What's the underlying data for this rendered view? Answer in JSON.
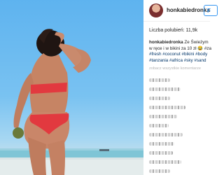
{
  "post": {
    "username": "honkabiedronka",
    "follow_label": "F",
    "likes_label": "Liczba polubień: 11,9k",
    "caption": {
      "user": "honkabiedronka",
      "line1": " Ze Świeżym",
      "line2": "w ręce i w bikini za 10 zł 😂 #za",
      "line3": "#fresh #coconut #bikini #body",
      "line4": "#tanzania #africa #sky #sand"
    },
    "show_comments_label": "zobacz wszystkie komentarze"
  },
  "colors": {
    "link": "#003569",
    "follow": "#3897f0",
    "muted": "#b5b5b5"
  },
  "icons": [
    "avatar-photo"
  ]
}
